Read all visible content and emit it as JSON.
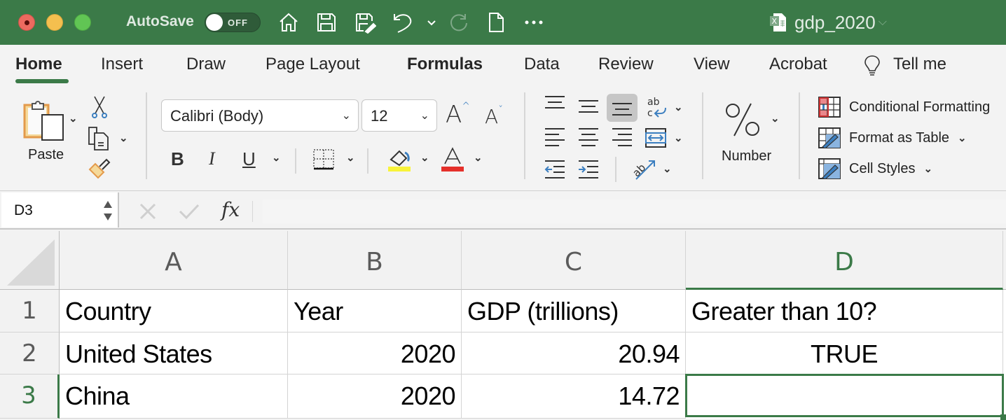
{
  "window": {
    "autosave_label": "AutoSave",
    "autosave_state": "OFF",
    "document_title": "gdp_2020",
    "accent_color": "#3b7a48"
  },
  "quick_access": {
    "icons": [
      "home-icon",
      "save-icon",
      "save-as-icon",
      "undo-icon",
      "undo-dropdown-icon",
      "redo-icon",
      "new-document-icon",
      "more-icon"
    ]
  },
  "tabs": [
    {
      "label": "Home",
      "active": true
    },
    {
      "label": "Insert"
    },
    {
      "label": "Draw"
    },
    {
      "label": "Page Layout"
    },
    {
      "label": "Formulas"
    },
    {
      "label": "Data"
    },
    {
      "label": "Review"
    },
    {
      "label": "View"
    },
    {
      "label": "Acrobat"
    },
    {
      "label": "Tell me"
    }
  ],
  "ribbon": {
    "paste_label": "Paste",
    "font_name": "Calibri (Body)",
    "font_size": "12",
    "bold": "B",
    "italic": "I",
    "underline": "U",
    "number_label": "Number",
    "conditional_formatting": "Conditional Formatting",
    "format_as_table": "Format as Table",
    "cell_styles": "Cell Styles",
    "highlight_color": "#f8f33a",
    "font_color": "#e5302a"
  },
  "formula_bar": {
    "name_box": "D3",
    "fx_label": "fx",
    "formula": ""
  },
  "sheet": {
    "columns": [
      "A",
      "B",
      "C",
      "D"
    ],
    "rows": [
      "1",
      "2",
      "3"
    ],
    "selected_cell": "D3",
    "cells": [
      [
        "Country",
        "Year",
        "GDP (trillions)",
        "Greater than 10?"
      ],
      [
        "United States",
        "2020",
        "20.94",
        "TRUE"
      ],
      [
        "China",
        "2020",
        "14.72",
        ""
      ]
    ]
  }
}
